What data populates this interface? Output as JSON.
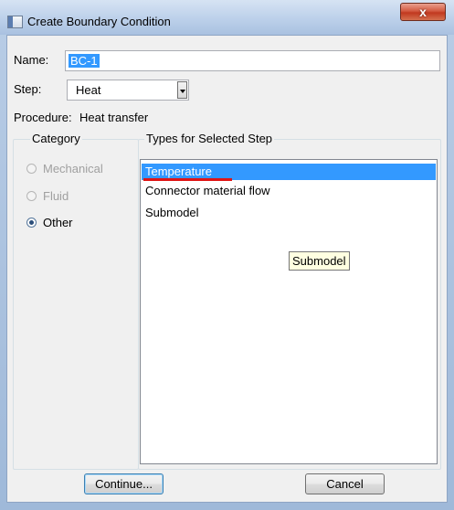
{
  "window": {
    "title": "Create Boundary Condition",
    "close_glyph": "x"
  },
  "form": {
    "name_label": "Name:",
    "name_value": "BC-1",
    "step_label": "Step:",
    "step_value": "Heat",
    "procedure_label": "Procedure:",
    "procedure_value": "Heat transfer"
  },
  "category": {
    "title": "Category",
    "options": [
      {
        "label": "Mechanical",
        "enabled": false,
        "selected": false
      },
      {
        "label": "Fluid",
        "enabled": false,
        "selected": false
      },
      {
        "label": "Other",
        "enabled": true,
        "selected": true
      }
    ]
  },
  "types": {
    "title": "Types for Selected Step",
    "items": [
      {
        "label": "Temperature",
        "selected": true
      },
      {
        "label": "Connector material flow",
        "selected": false
      },
      {
        "label": "Submodel",
        "selected": false
      }
    ],
    "tooltip": "Submodel"
  },
  "buttons": {
    "continue": "Continue...",
    "cancel": "Cancel"
  },
  "colors": {
    "selection": "#3399ff",
    "annotation_underline": "#e01515"
  }
}
